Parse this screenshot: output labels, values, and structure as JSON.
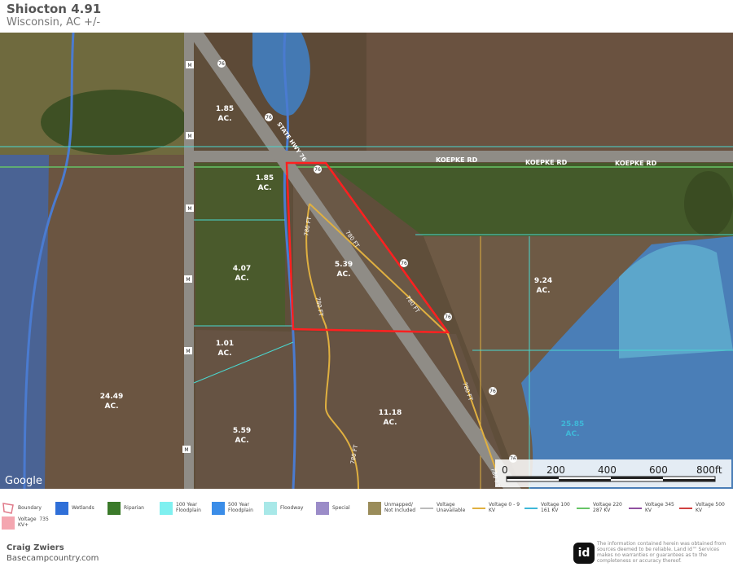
{
  "header": {
    "title": "Shiocton 4.91",
    "subtitle": "Wisconsin,  AC +/-"
  },
  "map": {
    "watermark": "Google",
    "roads": {
      "koepke": "KOEPKE RD",
      "hwy": "STATE HWY 76",
      "route_badge": "76",
      "county_badge": "M"
    },
    "parcels": [
      "1.85\nAC.",
      "1.85\nAC.",
      "4.07\nAC.",
      "5.39\nAC.",
      "9.24\nAC.",
      "1.01\nAC.",
      "24.49\nAC.",
      "5.59\nAC.",
      "11.18\nAC.",
      "25.85\nAC."
    ],
    "parcel_labels": [
      {
        "value": "1.85",
        "unit": "AC."
      },
      {
        "value": "1.85",
        "unit": "AC."
      },
      {
        "value": "4.07",
        "unit": "AC."
      },
      {
        "value": "5.39",
        "unit": "AC."
      },
      {
        "value": "9.24",
        "unit": "AC."
      },
      {
        "value": "1.01",
        "unit": "AC."
      },
      {
        "value": "24.49",
        "unit": "AC."
      },
      {
        "value": "5.59",
        "unit": "AC."
      },
      {
        "value": "11.18",
        "unit": "AC."
      },
      {
        "value": "25.85",
        "unit": "AC."
      }
    ],
    "dimension_label": "780 FT",
    "scale": {
      "ticks": [
        "0",
        "200",
        "400",
        "600",
        "800ft"
      ]
    }
  },
  "legend": {
    "items": [
      {
        "label": "Boundary",
        "color": "#e07a8a"
      },
      {
        "label": "Wetlands",
        "color": "#2f6fd8"
      },
      {
        "label": "Riparian",
        "color": "#3b7a2a"
      },
      {
        "label": "100 Year\nFloodplain",
        "color": "#7ff0f0"
      },
      {
        "label": "500 Year\nFloodplain",
        "color": "#3b8de8"
      },
      {
        "label": "Floodway",
        "color": "#a8e8e8"
      },
      {
        "label": "Special",
        "color": "#9b8cc8"
      },
      {
        "label": "Unmapped/\nNot Included",
        "color": "#9a8c5a"
      },
      {
        "label": "Voltage\nUnavailable",
        "color": "#bbbbbb"
      },
      {
        "label": "Voltage 0 - 9\nKV",
        "color": "#e0b040"
      },
      {
        "label": "Voltage 100\n161 KV",
        "color": "#3fb8d8"
      },
      {
        "label": "Voltage 220\n287 KV",
        "color": "#66c466"
      },
      {
        "label": "Voltage 345\nKV",
        "color": "#9050a0"
      },
      {
        "label": "Voltage 500\nKV",
        "color": "#d04040"
      },
      {
        "label": "Voltage  735\nKV+",
        "color": "#f4a6b0"
      }
    ]
  },
  "footer": {
    "name": "Craig Zwiers",
    "site": "Basecampcountry.com",
    "logo": "id",
    "disclaimer": "The information contained herein was obtained from sources deemed to be reliable. Land id™ Services makes no warranties or guarantees as to the completeness or accuracy thereof."
  }
}
